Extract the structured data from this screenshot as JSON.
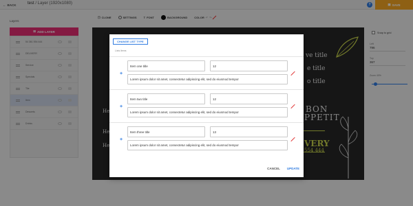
{
  "header": {
    "back_label": "BACK",
    "title": "test",
    "subtitle": "/ Layer (1920x1080)",
    "help_label": "?",
    "save_label": "SAVE"
  },
  "colors": {
    "accent": "#2f7be0",
    "save": "#f5a623",
    "add_layer": "#e32d73",
    "danger": "#e23c3c"
  },
  "toolbar": {
    "items": [
      "CLONE",
      "SETTINGS",
      "FONT",
      "BACKGROUND",
      "COLOR"
    ]
  },
  "left_panel": {
    "title": "Layers",
    "add_layer_label": "ADD LAYER",
    "layers": [
      "54 361 554 444",
      "DELIVERY",
      "Service",
      "Specials",
      "Tile",
      "Item",
      "Desserts",
      "Drinks"
    ]
  },
  "right_panel": {
    "snap_label": "Snap to grid",
    "left_label": "Left",
    "left_value": "796",
    "top_label": "Top",
    "top_value": "367",
    "zoom_label": "Zoom 40%",
    "zoom_fraction": 0.1
  },
  "canvas": {
    "texts": {
      "r1": "ve title",
      "r2": "e title",
      "r3": "o title",
      "r4": "BON",
      "r5": "PPETIT",
      "r6": "VERY",
      "r7": "554 444",
      "l1": "He",
      "l2": "He",
      "l3": "He"
    }
  },
  "modal": {
    "change_type_label": "CHANGE LIST TYPE",
    "item_name_label": "Lists items",
    "items": [
      {
        "title": "Item one title",
        "value": "12",
        "desc": "Lorem ipsum dolor sit amet, consectetur adipiscing elit, sed do eiusmod tempor"
      },
      {
        "title": "Item two title",
        "value": "12",
        "desc": "Lorem ipsum dolor sit amet, consectetur adipiscing elit, sed do eiusmod tempor"
      },
      {
        "title": "Item three title",
        "value": "13",
        "desc": "Lorem ipsum dolor sit amet, consectetur adipiscing elit, sed do eiusmod tempor"
      }
    ],
    "cancel_label": "CANCEL",
    "update_label": "UPDATE"
  }
}
